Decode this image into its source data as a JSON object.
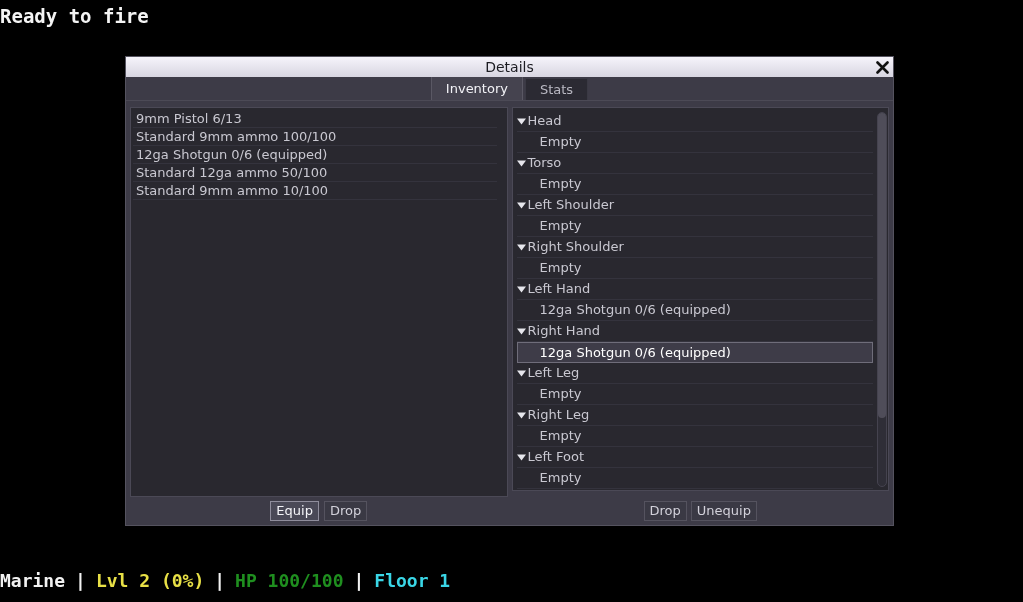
{
  "message": "Ready to fire",
  "dialog": {
    "title": "Details",
    "tabs": [
      {
        "label": "Inventory",
        "selected": true
      },
      {
        "label": "Stats",
        "selected": false
      }
    ],
    "inventory": {
      "items": [
        {
          "label": "9mm Pistol 6/13",
          "selected": false
        },
        {
          "label": "Standard 9mm ammo 100/100",
          "selected": false
        },
        {
          "label": "12ga Shotgun 0/6 (equipped)",
          "selected": false
        },
        {
          "label": "Standard 12ga ammo 50/100",
          "selected": false
        },
        {
          "label": "Standard 9mm ammo 10/100",
          "selected": false
        }
      ],
      "buttons": [
        {
          "label": "Equip",
          "focused": true
        },
        {
          "label": "Drop",
          "focused": false
        }
      ]
    },
    "equipment": {
      "slots": [
        {
          "label": "Head",
          "expanded": true,
          "selected": false,
          "children": [
            {
              "label": "Empty",
              "selected": false
            }
          ]
        },
        {
          "label": "Torso",
          "expanded": true,
          "selected": false,
          "children": [
            {
              "label": "Empty",
              "selected": false
            }
          ]
        },
        {
          "label": "Left Shoulder",
          "expanded": true,
          "selected": false,
          "children": [
            {
              "label": "Empty",
              "selected": false
            }
          ]
        },
        {
          "label": "Right Shoulder",
          "expanded": true,
          "selected": false,
          "children": [
            {
              "label": "Empty",
              "selected": false
            }
          ]
        },
        {
          "label": "Left Hand",
          "expanded": true,
          "selected": false,
          "children": [
            {
              "label": "12ga Shotgun 0/6 (equipped)",
              "selected": false
            }
          ]
        },
        {
          "label": "Right Hand",
          "expanded": true,
          "selected": false,
          "children": [
            {
              "label": "12ga Shotgun 0/6 (equipped)",
              "selected": true
            }
          ]
        },
        {
          "label": "Left Leg",
          "expanded": true,
          "selected": false,
          "children": [
            {
              "label": "Empty",
              "selected": false
            }
          ]
        },
        {
          "label": "Right Leg",
          "expanded": true,
          "selected": false,
          "children": [
            {
              "label": "Empty",
              "selected": false
            }
          ]
        },
        {
          "label": "Left Foot",
          "expanded": true,
          "selected": false,
          "children": [
            {
              "label": "Empty",
              "selected": false
            }
          ]
        }
      ],
      "buttons": [
        {
          "label": "Drop",
          "focused": false
        },
        {
          "label": "Unequip",
          "focused": false
        }
      ]
    }
  },
  "status_bar": [
    {
      "text": "Marine",
      "color": "#f2f2f2"
    },
    {
      "text": "|",
      "color": "#f2f2f2"
    },
    {
      "text": "Lvl 2 (0%)",
      "color": "#e8e046"
    },
    {
      "text": "|",
      "color": "#f2f2f2"
    },
    {
      "text": "HP 100/100",
      "color": "#1f8f1f"
    },
    {
      "text": "|",
      "color": "#f2f2f2"
    },
    {
      "text": "Floor 1",
      "color": "#3ad6e6"
    }
  ]
}
